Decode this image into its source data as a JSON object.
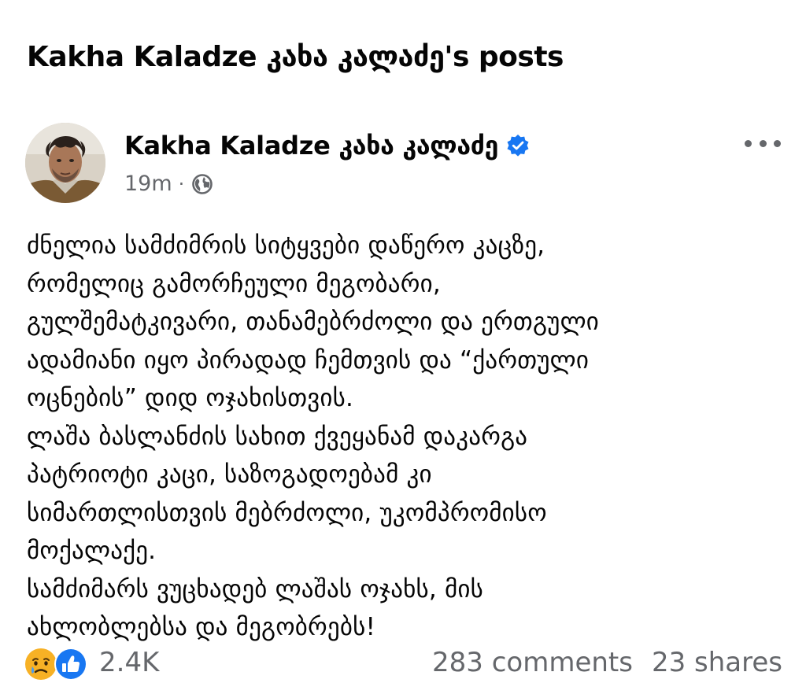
{
  "page": {
    "title": "Kakha Kaladze კახა კალაძე's posts"
  },
  "post": {
    "author": "Kakha Kaladze კახა კალაძე",
    "time": "19m",
    "separator": "·",
    "body_lines": [
      "ძნელია სამძიმრის სიტყვები დაწერო კაცზე,",
      "რომელიც გამორჩეული მეგობარი,",
      "გულშემატკივარი, თანამებრძოლი და ერთგული",
      "ადამიანი იყო პირადად ჩემთვის და “ქართული",
      "ოცნების” დიდ ოჯახისთვის.",
      "ლაშა ბასლანძის სახით ქვეყანამ დაკარგა",
      "პატრიოტი კაცი, საზოგადოებამ კი",
      "სიმართლისთვის მებრძოლი, უკომპრომისო",
      "მოქალაქე.",
      "სამძიმარს ვუცხადებ ლაშას ოჯახს, მის",
      "ახლობლებსა და მეგობრებს!"
    ],
    "reactions": {
      "count": "2.4K",
      "icons": [
        "sad-reaction-icon",
        "like-reaction-icon"
      ]
    },
    "comments": "283 comments",
    "shares": "23 shares"
  },
  "colors": {
    "text_primary": "#050505",
    "text_secondary": "#65676b",
    "verified_blue": "#1877f2",
    "like_blue": "#1877f2",
    "sad_yellow": "#f7b125"
  },
  "icons": {
    "verified": "verified-badge-icon",
    "privacy": "globe-icon",
    "more": "more-options-icon"
  }
}
